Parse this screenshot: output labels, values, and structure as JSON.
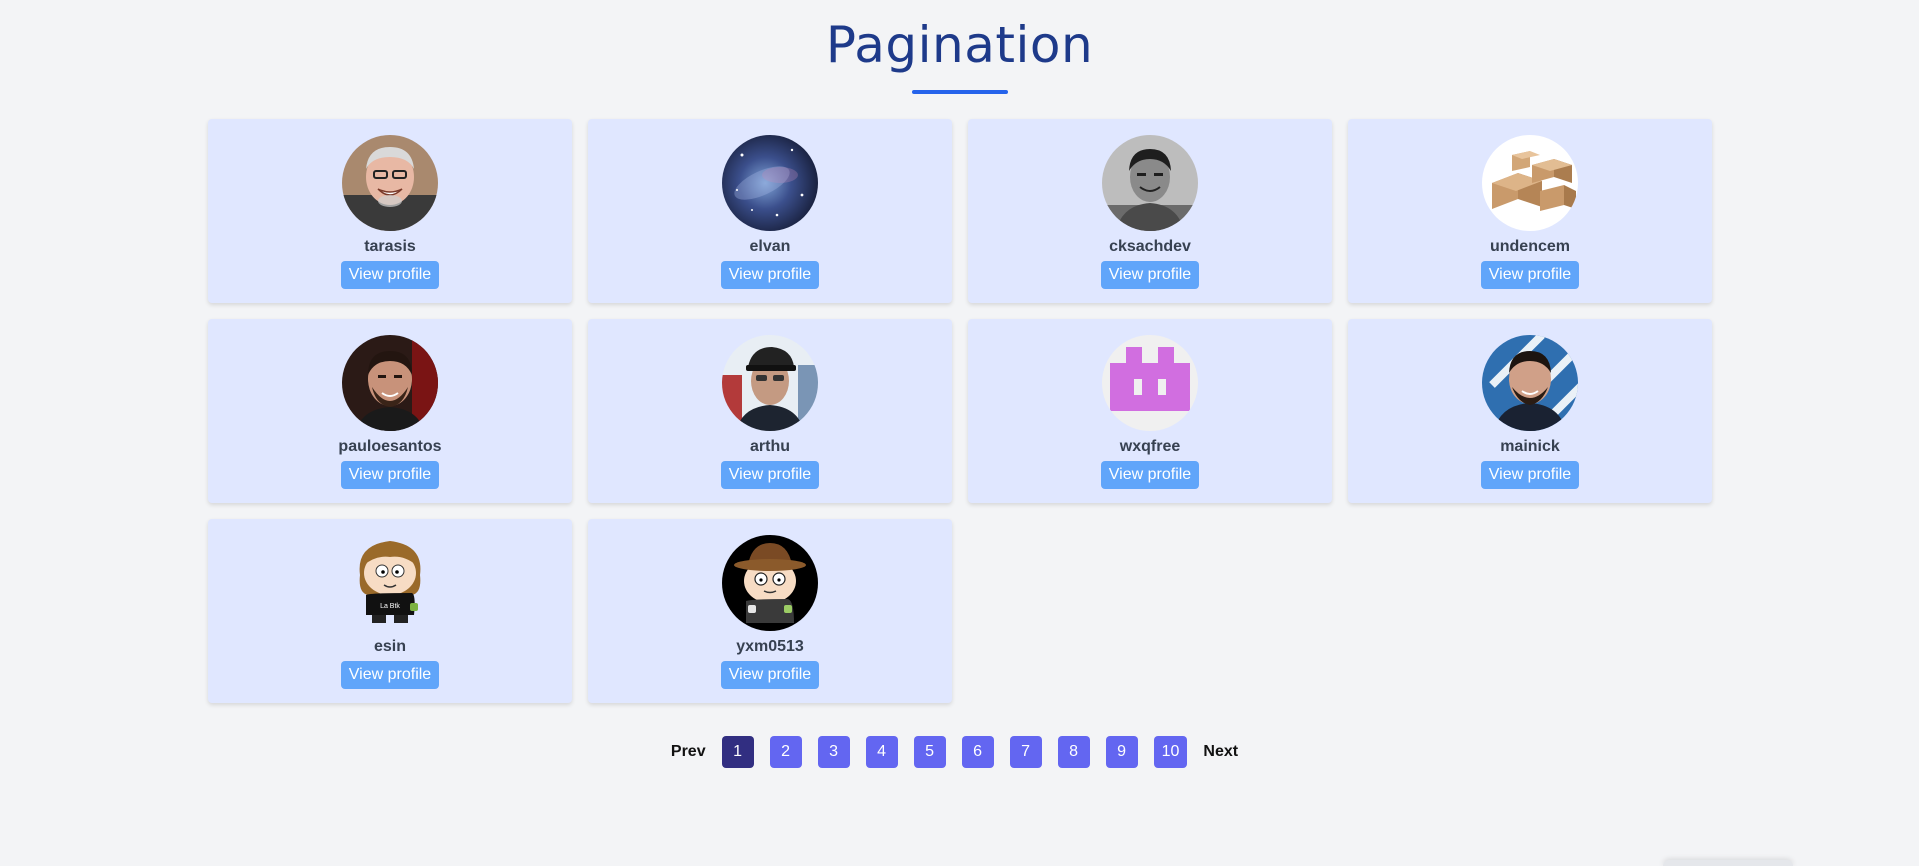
{
  "page": {
    "title": "Pagination",
    "accent_color": "#2563eb",
    "title_color": "#1e3a8a",
    "card_bg": "#e0e7ff",
    "button_color": "#60a5fa"
  },
  "profiles": [
    {
      "username": "tarasis",
      "button_label": "View profile",
      "avatar": "photo-grey-haired-man"
    },
    {
      "username": "elvan",
      "button_label": "View profile",
      "avatar": "galaxy-nebula"
    },
    {
      "username": "cksachdev",
      "button_label": "View profile",
      "avatar": "bw-photo-man"
    },
    {
      "username": "undencem",
      "button_label": "View profile",
      "avatar": "cardboard-boxes"
    },
    {
      "username": "pauloesantos",
      "button_label": "View profile",
      "avatar": "photo-bearded-man"
    },
    {
      "username": "arthu",
      "button_label": "View profile",
      "avatar": "photo-man-cap"
    },
    {
      "username": "wxqfree",
      "button_label": "View profile",
      "avatar": "identicon-purple"
    },
    {
      "username": "mainick",
      "button_label": "View profile",
      "avatar": "photo-man-blue-pattern"
    },
    {
      "username": "esin",
      "button_label": "View profile",
      "avatar": "cartoon-character-la-btk"
    },
    {
      "username": "yxm0513",
      "button_label": "View profile",
      "avatar": "cartoon-character-hat"
    }
  ],
  "cartoon_shirt_text": "La Btk",
  "pagination": {
    "prev_label": "Prev",
    "next_label": "Next",
    "pages": [
      "1",
      "2",
      "3",
      "4",
      "5",
      "6",
      "7",
      "8",
      "9",
      "10"
    ],
    "current_page": "1",
    "button_color": "#6366f1",
    "active_color": "#312e81"
  }
}
